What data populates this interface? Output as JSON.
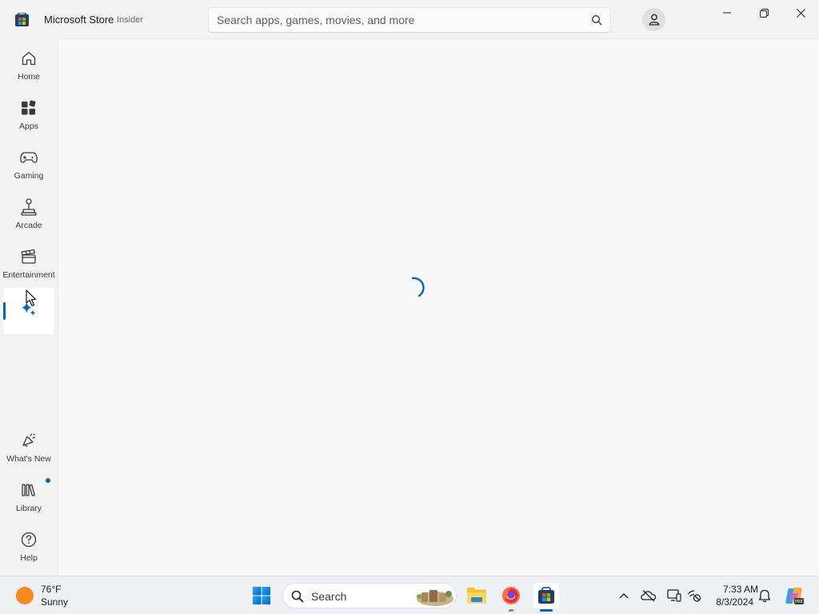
{
  "window": {
    "title": "Microsoft Store",
    "badge": "Insider",
    "controls": [
      "minimize-icon",
      "restore-icon",
      "close-icon"
    ]
  },
  "search": {
    "placeholder": "Search apps, games, movies, and more",
    "value": "",
    "icon": "search-icon"
  },
  "profile": {
    "icon": "user-icon"
  },
  "sidebar": {
    "items": [
      {
        "label": "Home",
        "icon": "home-icon",
        "selected": false
      },
      {
        "label": "Apps",
        "icon": "apps-icon",
        "selected": false
      },
      {
        "label": "Gaming",
        "icon": "gamepad-icon",
        "selected": false
      },
      {
        "label": "Arcade",
        "icon": "joystick-icon",
        "selected": false
      },
      {
        "label": "Entertainment",
        "icon": "clapperboard-icon",
        "selected": false
      },
      {
        "label": "",
        "icon": "sparkle-icon",
        "selected": true
      }
    ],
    "bottom_items": [
      {
        "label": "What's New",
        "icon": "megaphone-icon"
      },
      {
        "label": "Library",
        "icon": "library-icon",
        "has_notification": true
      },
      {
        "label": "Help",
        "icon": "help-icon"
      }
    ]
  },
  "content": {
    "state": "loading",
    "indicator": "spinner-icon"
  },
  "taskbar": {
    "weather": {
      "temperature": "76°F",
      "condition": "Sunny"
    },
    "search_label": "Search",
    "pinned": [
      "start-icon",
      "file-explorer-icon",
      "firefox-icon",
      "microsoft-store-icon"
    ],
    "tray": [
      "chevron-up-icon",
      "onedrive-offline-icon",
      "display-icon",
      "network-icon",
      "bell-icon",
      "copilot-icon"
    ],
    "time": "7:33 AM",
    "date": "8/3/2024"
  },
  "colors": {
    "accent": "#0067c0",
    "window_bg": "#f3f3f3",
    "content_bg": "#f9f9f9",
    "weather_sun": "#f7891e"
  }
}
